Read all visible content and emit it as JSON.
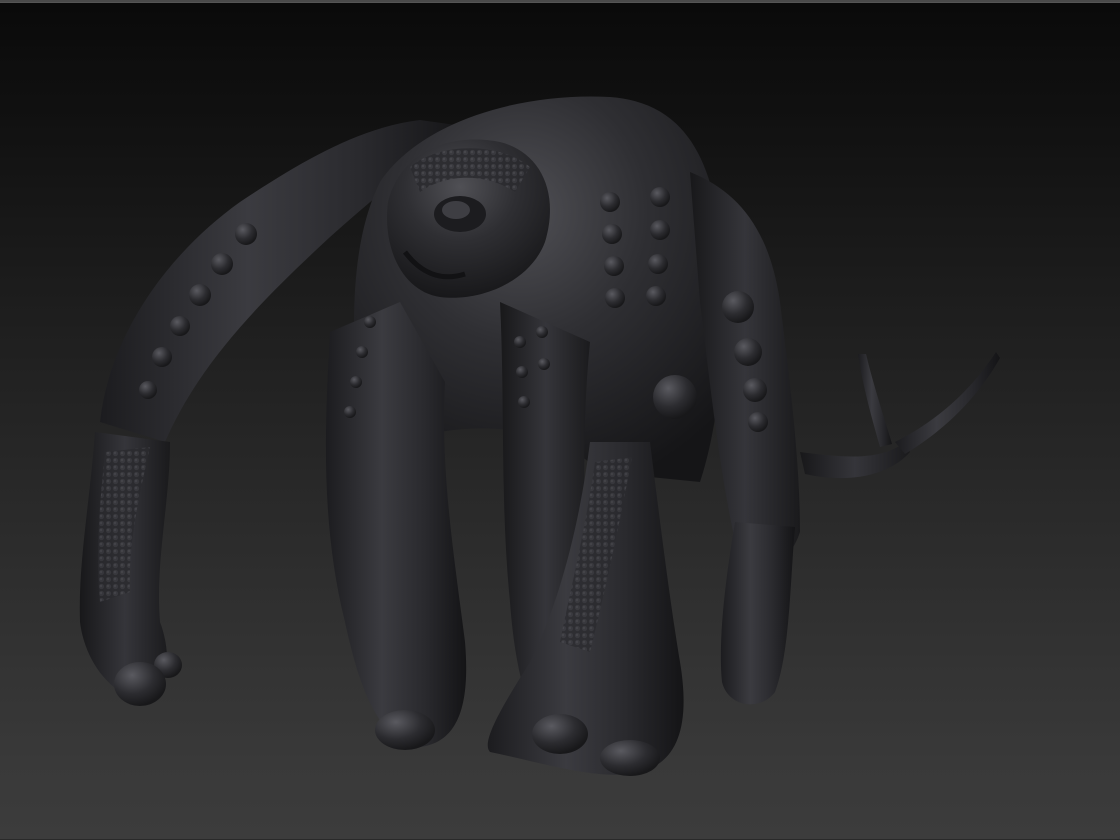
{
  "canvas": {
    "background_top": "#0a0a0a",
    "background_bottom": "#3c3c3c",
    "frame_color": "#4a4a4a"
  },
  "model": {
    "subject": "sculpted-creature-model",
    "material_base": "#2e2e30",
    "material_highlight": "#4a4a4e",
    "material_shadow": "#161618"
  }
}
